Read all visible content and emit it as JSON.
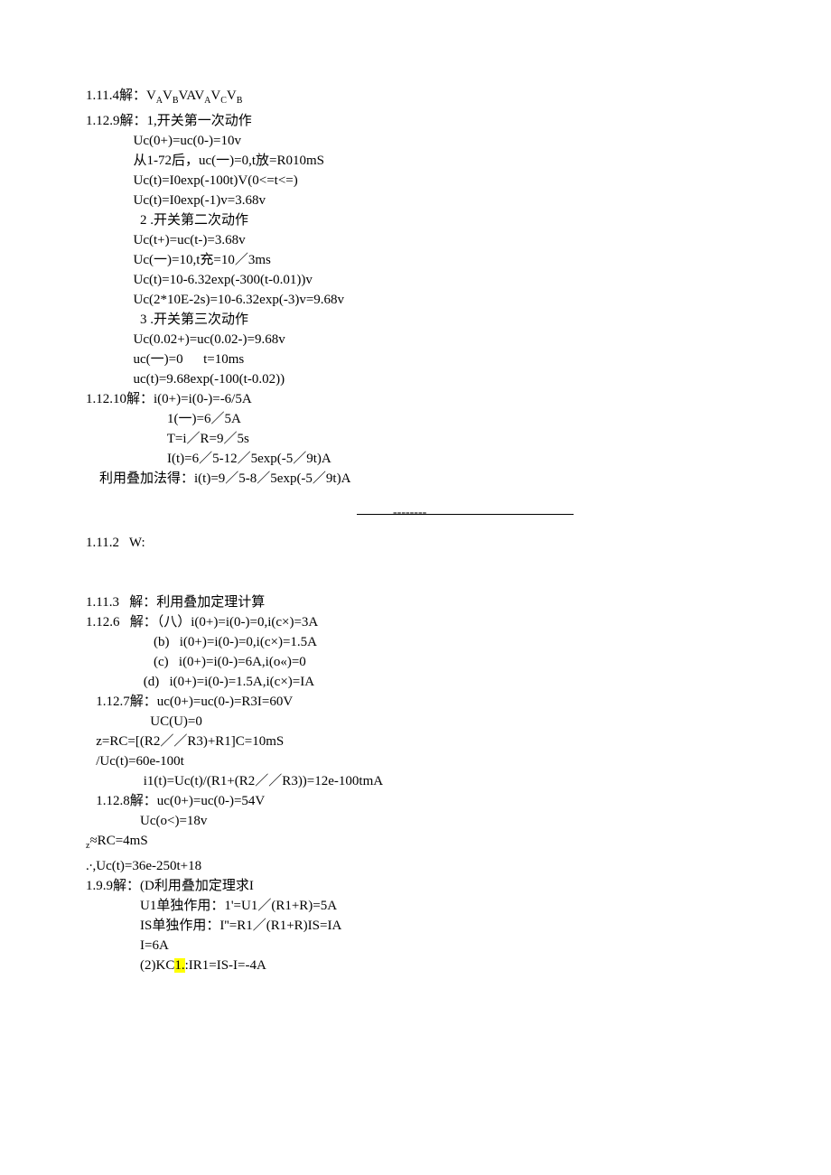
{
  "lines": {
    "l01": "1.11.4解：V",
    "l01a": "A",
    "l01b": "V",
    "l01c": "B",
    "l01d": "VAV",
    "l01e": "A",
    "l01f": "V",
    "l01g": "C",
    "l01h": "V",
    "l01i": "B",
    "l02": "1.12.9解：1,开关第一次动作",
    "l03": "              Uc(0+)=uc(0-)=10v",
    "l04": "              从1-72后，uc(一)=0,t放=R010mS",
    "l05": "              Uc(t)=I0exp(-100t)V(0<=t<=)",
    "l06": "              Uc(t)=I0exp(-1)v=3.68v",
    "l07": "                2 .开关第二次动作",
    "l08": "              Uc(t+)=uc(t-)=3.68v",
    "l09": "              Uc(一)=10,t充=10／3ms",
    "l10": "              Uc(t)=10-6.32exp(-300(t-0.01))v",
    "l11": "              Uc(2*10E-2s)=10-6.32exp(-3)v=9.68v",
    "l12": "                3 .开关第三次动作",
    "l13": "              Uc(0.02+)=uc(0.02-)=9.68v",
    "l14": "              uc(一)=0      t=10ms",
    "l15": "              uc(t)=9.68exp(-100(t-0.02))",
    "l16": "1.12.10解：i(0+)=i(0-)=-6/5A",
    "l17": "                        1(一)=6／5A",
    "l18": "                        T=i／R=9／5s",
    "l19": "                        I(t)=6／5-12／5exp(-5／9t)A",
    "l20": "    利用叠加法得：i(t)=9／5-8／5exp(-5／9t)A",
    "dashes": "--------",
    "l21": "1.11.2   W:",
    "l22": "1.11.3   解：利用叠加定理计算",
    "l23": "1.12.6   解：（八）i(0+)=i(0-)=0,i(c×)=3A",
    "l24": "                    (b)   i(0+)=i(0-)=0,i(c×)=1.5A",
    "l25": "                    (c)   i(0+)=i(0-)=6A,i(o«)=0",
    "l26": "                 (d)   i(0+)=i(0-)=1.5A,i(c×)=IA",
    "l27": "   1.12.7解：uc(0+)=uc(0-)=R3I=60V",
    "l28": "                   UC(U)=0",
    "l29": "   z=RC=[(R2／／R3)+R1]C=10mS",
    "l30": "   /Uc(t)=60e-100t",
    "l31": "                 i1(t)=Uc(t)/(R1+(R2／／R3))=12e-100tmA",
    "l32": "   1.12.8解：uc(0+)=uc(0-)=54V",
    "l33": "                Uc(o<)=18v",
    "l34a": "z",
    "l34b": "≈RC=4mS",
    "l35": ".∙,Uc(t)=36e-250t+18",
    "l36": "1.9.9解：(D利用叠加定理求I",
    "l37": "                U1单独作用：1'=U1／(R1+R)=5A",
    "l38": "                IS单独作用：I''=R1／(R1+R)IS=IA",
    "l39": "                I=6A",
    "l40a": "                (2)KC",
    "l40b": "1.",
    "l40c": ":IR1=IS-I=-4A"
  }
}
